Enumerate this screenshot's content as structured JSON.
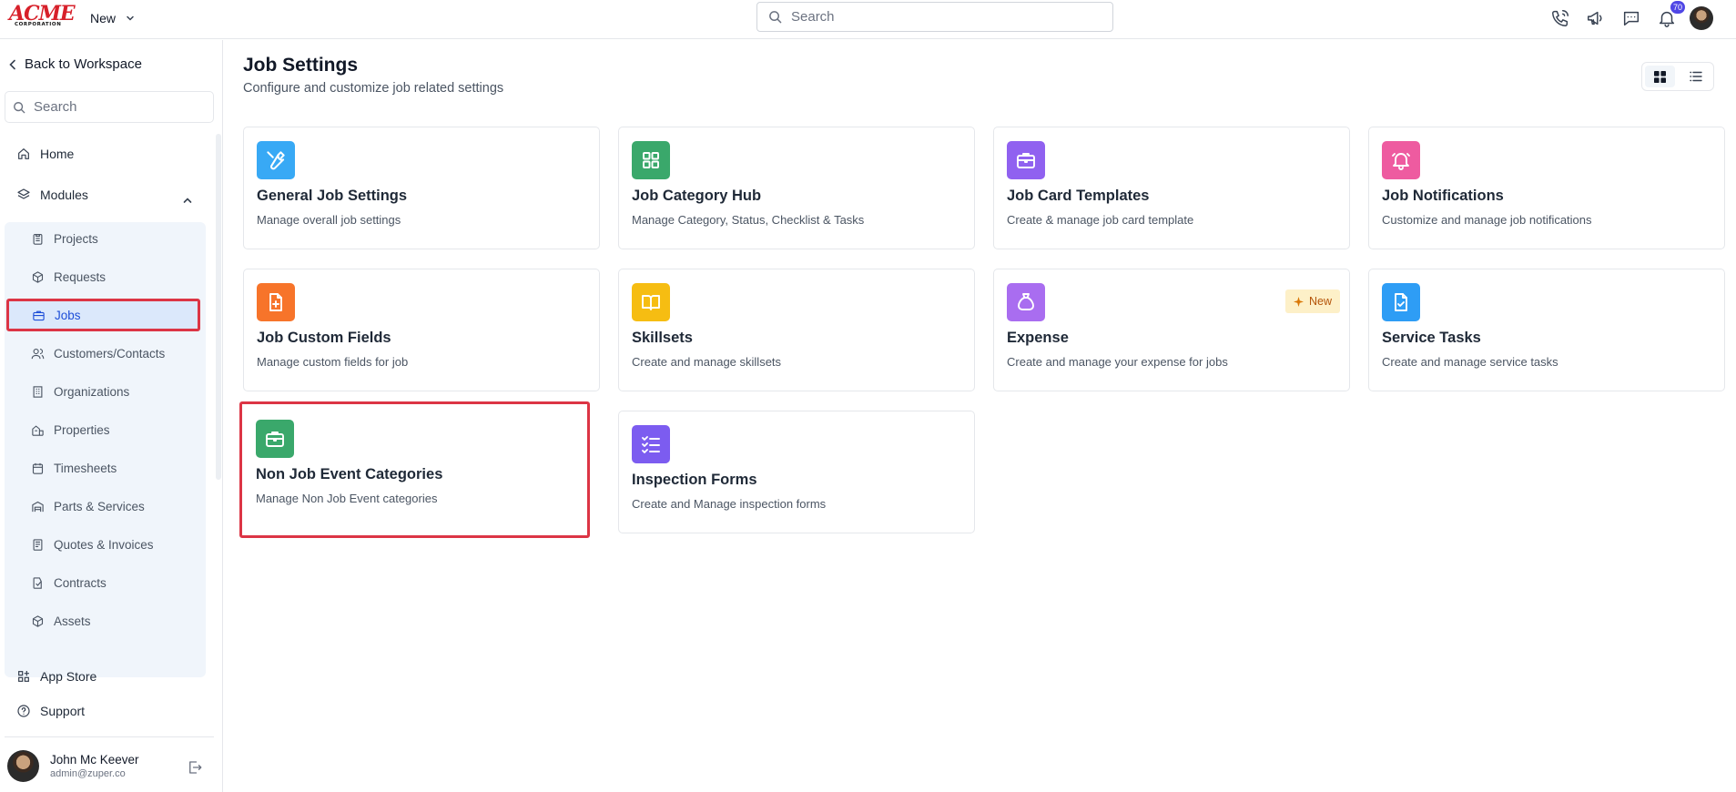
{
  "brand": {
    "logo_main": "ACME",
    "logo_sub": "CORPORATION"
  },
  "topbar": {
    "new_label": "New",
    "search_placeholder": "Search",
    "notifications_count": "70",
    "icons": [
      "phone-icon",
      "megaphone-icon",
      "chat-icon",
      "bell-icon"
    ]
  },
  "sidebar": {
    "back_label": "Back to Workspace",
    "search_placeholder": "Search",
    "home_label": "Home",
    "modules_label": "Modules",
    "modules": [
      {
        "label": "Projects",
        "icon": "clipboard-icon"
      },
      {
        "label": "Requests",
        "icon": "cube-check-icon"
      },
      {
        "label": "Jobs",
        "icon": "briefcase-icon",
        "active": true
      },
      {
        "label": "Customers/Contacts",
        "icon": "users-icon"
      },
      {
        "label": "Organizations",
        "icon": "building-icon"
      },
      {
        "label": "Properties",
        "icon": "house-icon"
      },
      {
        "label": "Timesheets",
        "icon": "calendar-icon"
      },
      {
        "label": "Parts & Services",
        "icon": "warehouse-icon"
      },
      {
        "label": "Quotes & Invoices",
        "icon": "receipt-icon"
      },
      {
        "label": "Contracts",
        "icon": "contract-icon"
      },
      {
        "label": "Assets",
        "icon": "box-icon"
      }
    ],
    "app_store_label": "App Store",
    "support_label": "Support",
    "user": {
      "name": "John Mc Keever",
      "email": "admin@zuper.co"
    }
  },
  "main": {
    "title": "Job Settings",
    "subtitle": "Configure and customize job related settings",
    "view_modes": [
      "grid",
      "list"
    ],
    "active_view": "grid",
    "cards": [
      {
        "title": "General Job Settings",
        "desc": "Manage overall job settings",
        "icon": "wrench-icon",
        "color": "#38a9f5"
      },
      {
        "title": "Job Category Hub",
        "desc": "Manage Category, Status, Checklist & Tasks",
        "icon": "grid-icon",
        "color": "#3aa86b"
      },
      {
        "title": "Job Card Templates",
        "desc": "Create & manage job card template",
        "icon": "briefcase-icon",
        "color": "#9061f0"
      },
      {
        "title": "Job Notifications",
        "desc": "Customize and manage job notifications",
        "icon": "bell-icon",
        "color": "#ee5ba0"
      },
      {
        "title": "Job Custom Fields",
        "desc": "Manage custom fields for job",
        "icon": "file-plus-icon",
        "color": "#f7742a"
      },
      {
        "title": "Skillsets",
        "desc": "Create and manage skillsets",
        "icon": "book-icon",
        "color": "#f6bd12"
      },
      {
        "title": "Expense",
        "desc": "Create and manage your expense for jobs",
        "icon": "money-bag-icon",
        "color": "#a96df0",
        "tag": "New"
      },
      {
        "title": "Service Tasks",
        "desc": "Create and manage service tasks",
        "icon": "file-check-icon",
        "color": "#2e9df5"
      },
      {
        "title": "Non Job Event Categories",
        "desc": "Manage Non Job Event categories",
        "icon": "briefcase-icon",
        "color": "#3aa86b"
      },
      {
        "title": "Inspection Forms",
        "desc": "Create and Manage inspection forms",
        "icon": "checklist-icon",
        "color": "#7c5cf0"
      }
    ]
  }
}
